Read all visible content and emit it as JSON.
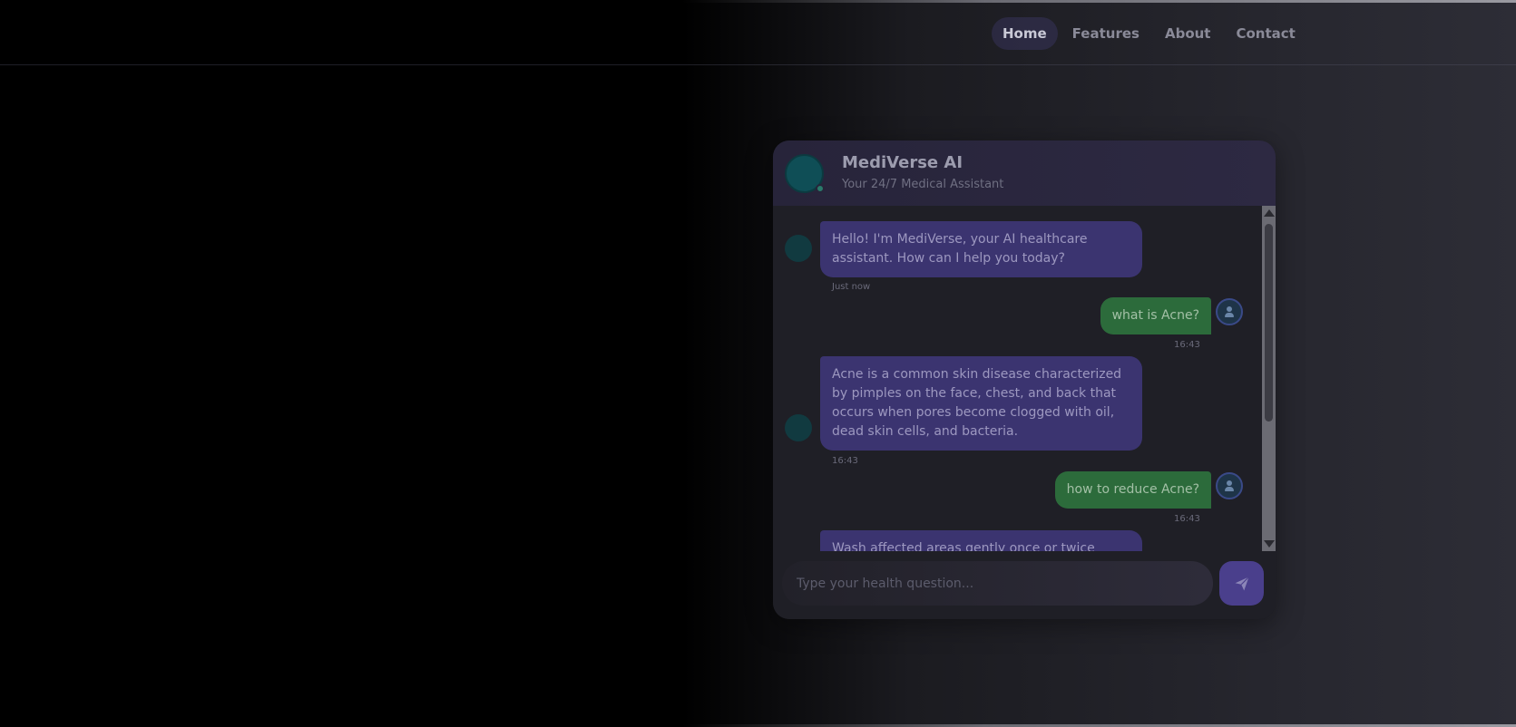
{
  "nav": {
    "items": [
      {
        "label": "Home"
      },
      {
        "label": "Features"
      },
      {
        "label": "About"
      },
      {
        "label": "Contact"
      }
    ]
  },
  "chat": {
    "title": "MediVerse AI",
    "subtitle": "Your 24/7 Medical Assistant",
    "messages": [
      {
        "sender": "bot",
        "text": "Hello! I'm MediVerse, your AI healthcare assistant. How can I help you today?",
        "time": "Just now"
      },
      {
        "sender": "user",
        "text": "what is Acne?",
        "time": "16:43"
      },
      {
        "sender": "bot",
        "text": "Acne is a common skin disease characterized by pimples on the face, chest, and back that occurs when pores become clogged with oil, dead skin cells, and bacteria.",
        "time": "16:43"
      },
      {
        "sender": "user",
        "text": "how to reduce Acne?",
        "time": "16:43"
      },
      {
        "sender": "bot",
        "text": "Wash affected areas gently once or twice",
        "time": ""
      }
    ],
    "input": {
      "placeholder": "Type your health question..."
    },
    "send_icon": "paper-plane-icon"
  },
  "colors": {
    "bot_bubble": "#3b3470",
    "user_bubble": "#2c6b3b",
    "accent": "#4a3f8c"
  }
}
